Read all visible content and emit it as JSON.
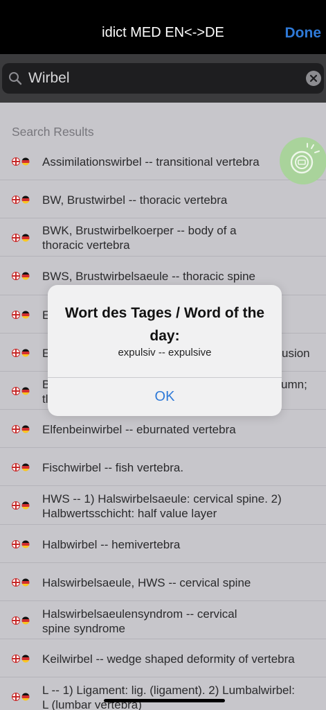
{
  "nav": {
    "title": "idict MED EN<->DE",
    "done_label": "Done"
  },
  "search": {
    "value": "Wirbel"
  },
  "results": {
    "header": "Search Results",
    "items": [
      {
        "text": "Assimilationswirbel -- transitional vertebra"
      },
      {
        "text": "BW, Brustwirbel -- thoracic vertebra"
      },
      {
        "line1": "BWK, Brustwirbelkoerper -- body of a",
        "line2": "thoracic vertebra"
      },
      {
        "text": "BWS, Brustwirbelsaeule -- thoracic spine"
      },
      {
        "text": "E"
      },
      {
        "text_left": "E",
        "text_right": "usion"
      },
      {
        "line1": "B",
        "line1_right": "umn;",
        "line2": "tl"
      },
      {
        "text": "Elfenbeinwirbel -- eburnated vertebra"
      },
      {
        "text": "Fischwirbel -- fish vertebra."
      },
      {
        "line1": "HWS -- 1) Halswirbelsaeule: cervical spine. 2)",
        "line2": "Halbwertsschicht: half value layer"
      },
      {
        "text": "Halbwirbel -- hemivertebra"
      },
      {
        "text": "Halswirbelsaeule, HWS -- cervical spine"
      },
      {
        "line1": "Halswirbelsaeulensyndrom -- cervical",
        "line2": "spine syndrome"
      },
      {
        "text": "Keilwirbel -- wedge shaped deformity of vertebra"
      },
      {
        "line1": "L -- 1) Ligament: lig. (ligament). 2) Lumbalwirbel:",
        "line2": "L (lumbar vertebra)"
      }
    ]
  },
  "dialog": {
    "title": "Wort des Tages / Word of the day:",
    "message": "expulsiv -- expulsive",
    "ok_label": "OK"
  },
  "colors": {
    "accent": "#2f7ad8",
    "fab": "#a9d39b",
    "list_bg": "#c7c6cb"
  }
}
